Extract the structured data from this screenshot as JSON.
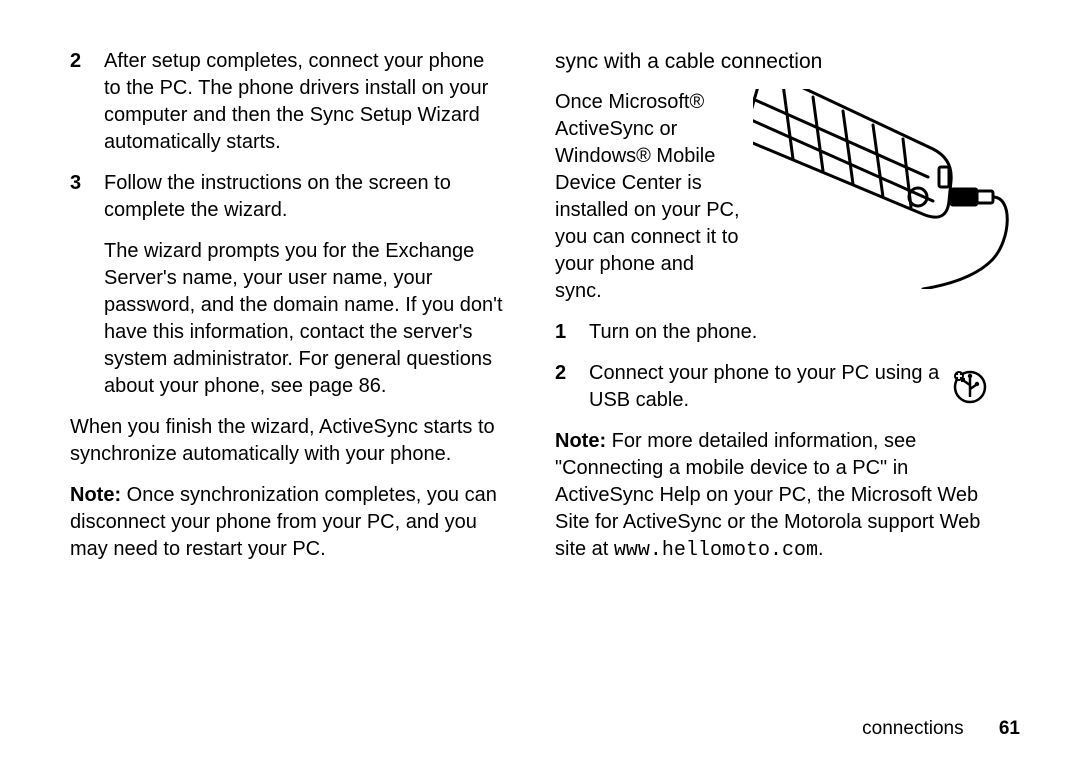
{
  "left": {
    "step2_num": "2",
    "step2_body": "After setup completes, connect your phone to the PC. The phone drivers install on your computer and then the Sync Setup Wizard automatically starts.",
    "step3_num": "3",
    "step3_body": "Follow the instructions on the screen to complete the wizard.",
    "step3_extra": "The wizard prompts you for the Exchange Server's name, your user name, your password, and the domain name. If you don't have this information, contact the server's system administrator. For general questions about your phone, see page 86.",
    "para_finish": "When you finish the wizard, ActiveSync starts to synchronize automatically with your phone.",
    "note_label": "Note:",
    "note_body": " Once synchronization completes, you can disconnect your phone from your PC, and you may need to restart your PC."
  },
  "right": {
    "heading": "sync with a cable connection",
    "intro": "Once Microsoft® ActiveSync or Windows® Mobile Device Center is installed on your PC, you can connect it to your phone and sync.",
    "step1_num": "1",
    "step1_body": "Turn on the phone.",
    "step2_num": "2",
    "step2_body": "Connect your phone to your PC using a USB cable.",
    "note_label": "Note:",
    "note_body_a": " For more detailed information, see \"Connecting a mobile device to a PC\" in ActiveSync Help on your PC, the Microsoft Web Site for ActiveSync or the Motorola support Web site at ",
    "note_url": "www.hellomoto.com",
    "note_body_b": "."
  },
  "footer": {
    "section": "connections",
    "page": "61"
  }
}
